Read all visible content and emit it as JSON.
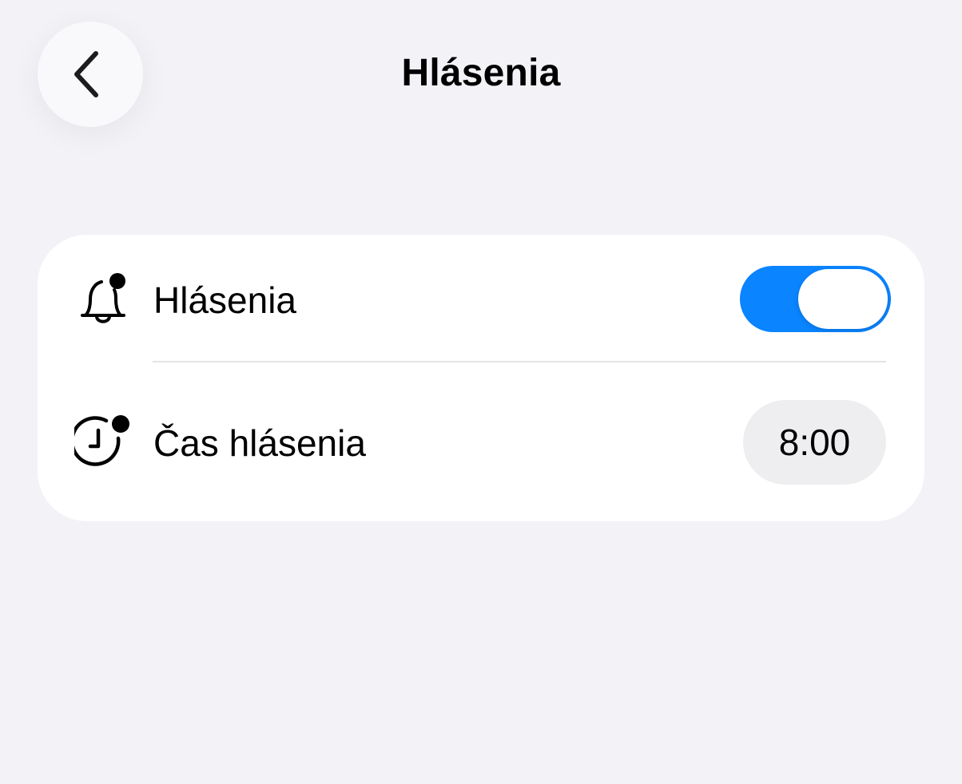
{
  "header": {
    "title": "Hlásenia",
    "back_icon": "chevron-left-icon"
  },
  "settings": {
    "notifications": {
      "label": "Hlásenia",
      "icon": "bell-badge-icon",
      "enabled": true
    },
    "notification_time": {
      "label": "Čas hlásenia",
      "icon": "clock-badge-icon",
      "value": "8:00"
    }
  },
  "colors": {
    "background": "#f2f2f7",
    "card": "#ffffff",
    "accent": "#0a84ff",
    "pill": "#eeeef0"
  }
}
